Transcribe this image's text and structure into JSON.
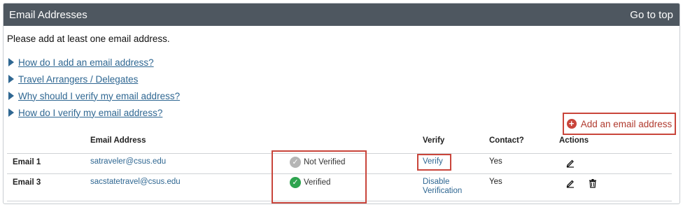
{
  "header": {
    "title": "Email Addresses",
    "go_to_top": "Go to top"
  },
  "intro": "Please add at least one email address.",
  "faq_links": [
    "How do I add an email address?",
    "Travel Arrangers / Delegates",
    "Why should I verify my email address?",
    "How do I verify my email address?"
  ],
  "add_button": "Add an email address",
  "table": {
    "columns": {
      "email": "Email Address",
      "verify": "Verify",
      "contact": "Contact?",
      "actions": "Actions"
    },
    "rows": [
      {
        "label": "Email 1",
        "email": "satraveler@csus.edu",
        "status": "Not Verified",
        "verify_action": "Verify",
        "contact": "Yes",
        "actions": [
          "edit-icon"
        ]
      },
      {
        "label": "Email 3",
        "email": "sacstatetravel@csus.edu",
        "status": "Verified",
        "verify_action_1": "Disable",
        "verify_action_2": "Verification",
        "contact": "Yes",
        "actions": [
          "edit-icon",
          "trash-icon"
        ]
      }
    ]
  },
  "colors": {
    "header_bg": "#4e5760",
    "link": "#2f6792",
    "highlight": "#c9453b",
    "verified": "#2ea44f",
    "not_verified": "#b5b5b5"
  }
}
